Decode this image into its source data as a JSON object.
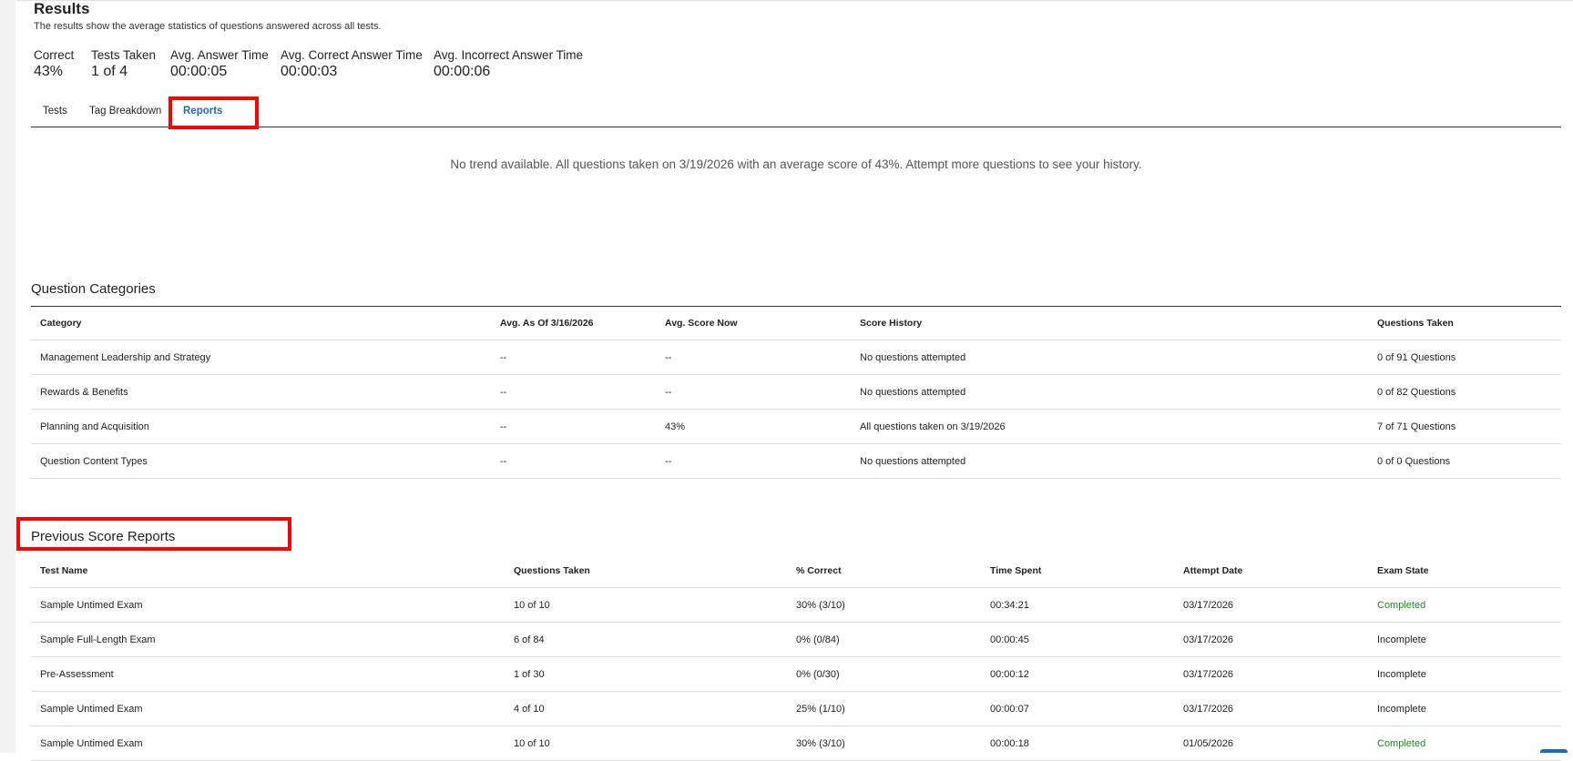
{
  "header": {
    "title": "Results",
    "subtitle": "The results show the average statistics of questions answered across all tests."
  },
  "stats": [
    {
      "label": "Correct",
      "value": "43%"
    },
    {
      "label": "Tests Taken",
      "value": "1 of 4"
    },
    {
      "label": "Avg. Answer Time",
      "value": "00:00:05"
    },
    {
      "label": "Avg. Correct Answer Time",
      "value": "00:00:03"
    },
    {
      "label": "Avg. Incorrect Answer Time",
      "value": "00:00:06"
    }
  ],
  "tabs": [
    {
      "label": "Tests",
      "active": false
    },
    {
      "label": "Tag Breakdown",
      "active": false
    },
    {
      "label": "Reports",
      "active": true
    }
  ],
  "trend_message": "No trend available. All questions taken on 3/19/2026 with an average score of 43%. Attempt more questions to see your history.",
  "categories": {
    "title": "Question Categories",
    "headers": [
      "Category",
      "Avg. As Of 3/16/2026",
      "Avg. Score Now",
      "Score History",
      "Questions Taken"
    ],
    "rows": [
      [
        "Management Leadership and Strategy",
        "--",
        "--",
        "No questions attempted",
        "0 of 91 Questions"
      ],
      [
        "Rewards & Benefits",
        "--",
        "--",
        "No questions attempted",
        "0 of 82 Questions"
      ],
      [
        "Planning and Acquisition",
        "--",
        "43%",
        "All questions taken on 3/19/2026",
        "7 of 71 Questions"
      ],
      [
        "Question Content Types",
        "--",
        "--",
        "No questions attempted",
        "0 of 0 Questions"
      ]
    ]
  },
  "reports": {
    "title": "Previous Score Reports",
    "headers": [
      "Test Name",
      "Questions Taken",
      "% Correct",
      "Time Spent",
      "Attempt Date",
      "Exam State"
    ],
    "rows": [
      [
        "Sample Untimed Exam",
        "10 of 10",
        "30% (3/10)",
        "00:34:21",
        "03/17/2026",
        "Completed"
      ],
      [
        "Sample Full-Length Exam",
        "6 of 84",
        "0% (0/84)",
        "00:00:45",
        "03/17/2026",
        "Incomplete"
      ],
      [
        "Pre-Assessment",
        "1 of 30",
        "0% (0/30)",
        "00:00:12",
        "03/17/2026",
        "Incomplete"
      ],
      [
        "Sample Untimed Exam",
        "4 of 10",
        "25% (1/10)",
        "00:00:07",
        "03/17/2026",
        "Incomplete"
      ],
      [
        "Sample Untimed Exam",
        "10 of 10",
        "30% (3/10)",
        "00:00:18",
        "01/05/2026",
        "Completed"
      ]
    ]
  },
  "colors": {
    "accent": "#1a6bb8",
    "completed": "#1e8a1e",
    "highlight": "#ff0000"
  }
}
